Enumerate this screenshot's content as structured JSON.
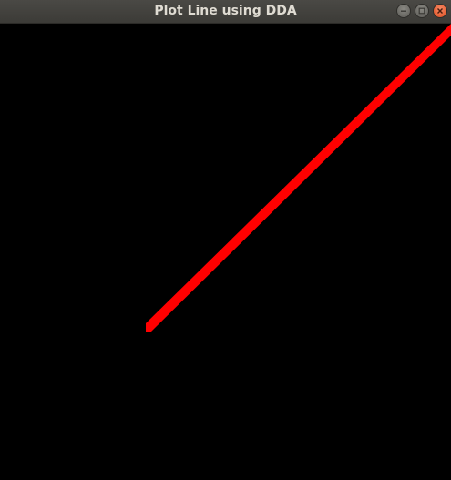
{
  "window": {
    "title": "Plot Line using DDA",
    "controls": [
      "minimize-icon",
      "maximize-icon",
      "close-icon"
    ]
  },
  "canvas": {
    "background_color": "#000000",
    "line_color": "#ff0000"
  }
}
